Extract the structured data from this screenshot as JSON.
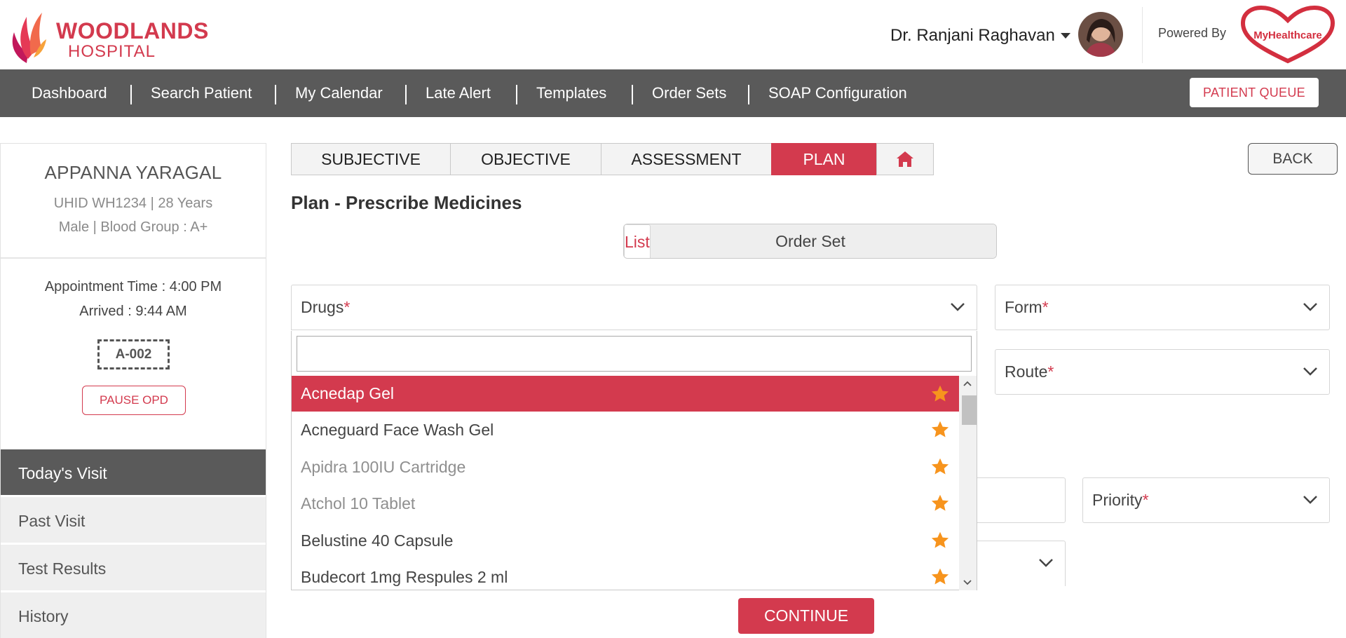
{
  "header": {
    "logo_line1": "WOODLANDS",
    "logo_line2": "HOSPITAL",
    "user_name": "Dr. Ranjani Raghavan",
    "powered_by": "Powered By",
    "partner_logo": "MyHealthcare"
  },
  "nav": {
    "items": [
      "Dashboard",
      "Search Patient",
      "My Calendar",
      "Late Alert",
      "Templates",
      "Order Sets",
      "SOAP Configuration"
    ],
    "patient_queue": "PATIENT QUEUE"
  },
  "patient": {
    "name": "APPANNA YARAGAL",
    "info1": "UHID WH1234 | 28 Years",
    "info2": "Male | Blood Group : A+",
    "appointment": "Appointment Time : 4:00 PM",
    "arrived": "Arrived : 9:44 AM",
    "token": "A-002",
    "pause_button": "PAUSE OPD"
  },
  "left_menu": [
    "Today's Visit",
    "Past Visit",
    "Test Results",
    "History"
  ],
  "soap_tabs": [
    "SUBJECTIVE",
    "OBJECTIVE",
    "ASSESSMENT",
    "PLAN"
  ],
  "active_tab": "PLAN",
  "back_button": "BACK",
  "section_title": "Plan - Prescribe Medicines",
  "toggle": {
    "list": "List",
    "order_set": "Order Set"
  },
  "fields": {
    "drugs": "Drugs",
    "form": "Form",
    "route": "Route",
    "priority": "Priority",
    "required_mark": "*"
  },
  "dropdown": {
    "search_value": "",
    "items": [
      {
        "label": "Acnedap Gel",
        "state": "highlighted"
      },
      {
        "label": "Acneguard Face Wash Gel",
        "state": "normal"
      },
      {
        "label": "Apidra 100IU Cartridge",
        "state": "dimmed"
      },
      {
        "label": "Atchol 10 Tablet",
        "state": "dimmed"
      },
      {
        "label": "Belustine 40 Capsule",
        "state": "normal"
      },
      {
        "label": "Budecort 1mg Respules 2 ml",
        "state": "normal"
      }
    ]
  },
  "continue_button": "CONTINUE",
  "colors": {
    "brand_red": "#d33a4e",
    "nav_grey": "#5a5a5a",
    "star_orange": "#f7941d"
  },
  "icons": [
    "home-icon",
    "star-icon",
    "chevron-down-icon",
    "caret-down-icon"
  ]
}
